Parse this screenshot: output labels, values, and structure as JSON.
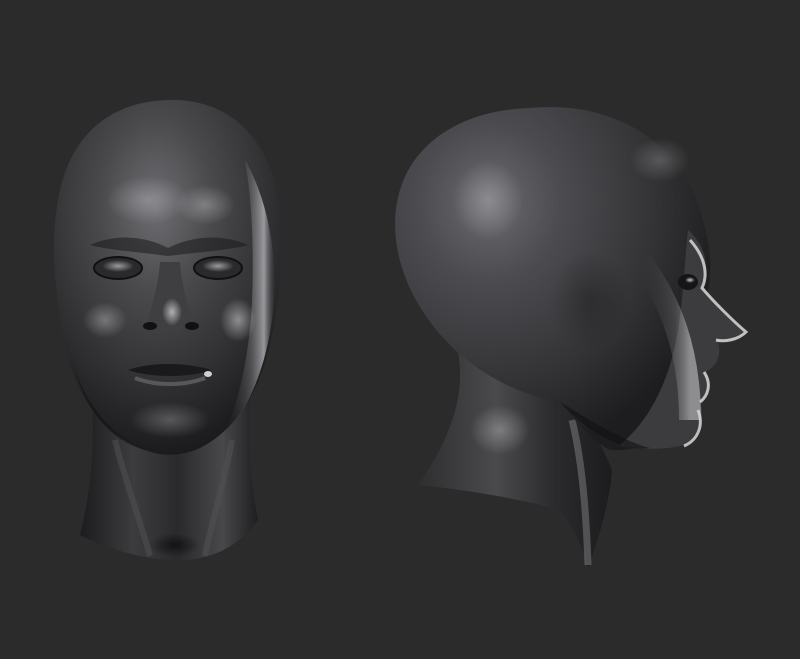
{
  "scene": {
    "background_color": "#2b2b2b",
    "subject": "sculpted-head-render",
    "views": [
      "front",
      "profile-right"
    ],
    "material": {
      "base": "#3a3a3c",
      "shadow": "#141416",
      "highlight": "#9a9a9e",
      "specular": "#d8d8da"
    }
  }
}
